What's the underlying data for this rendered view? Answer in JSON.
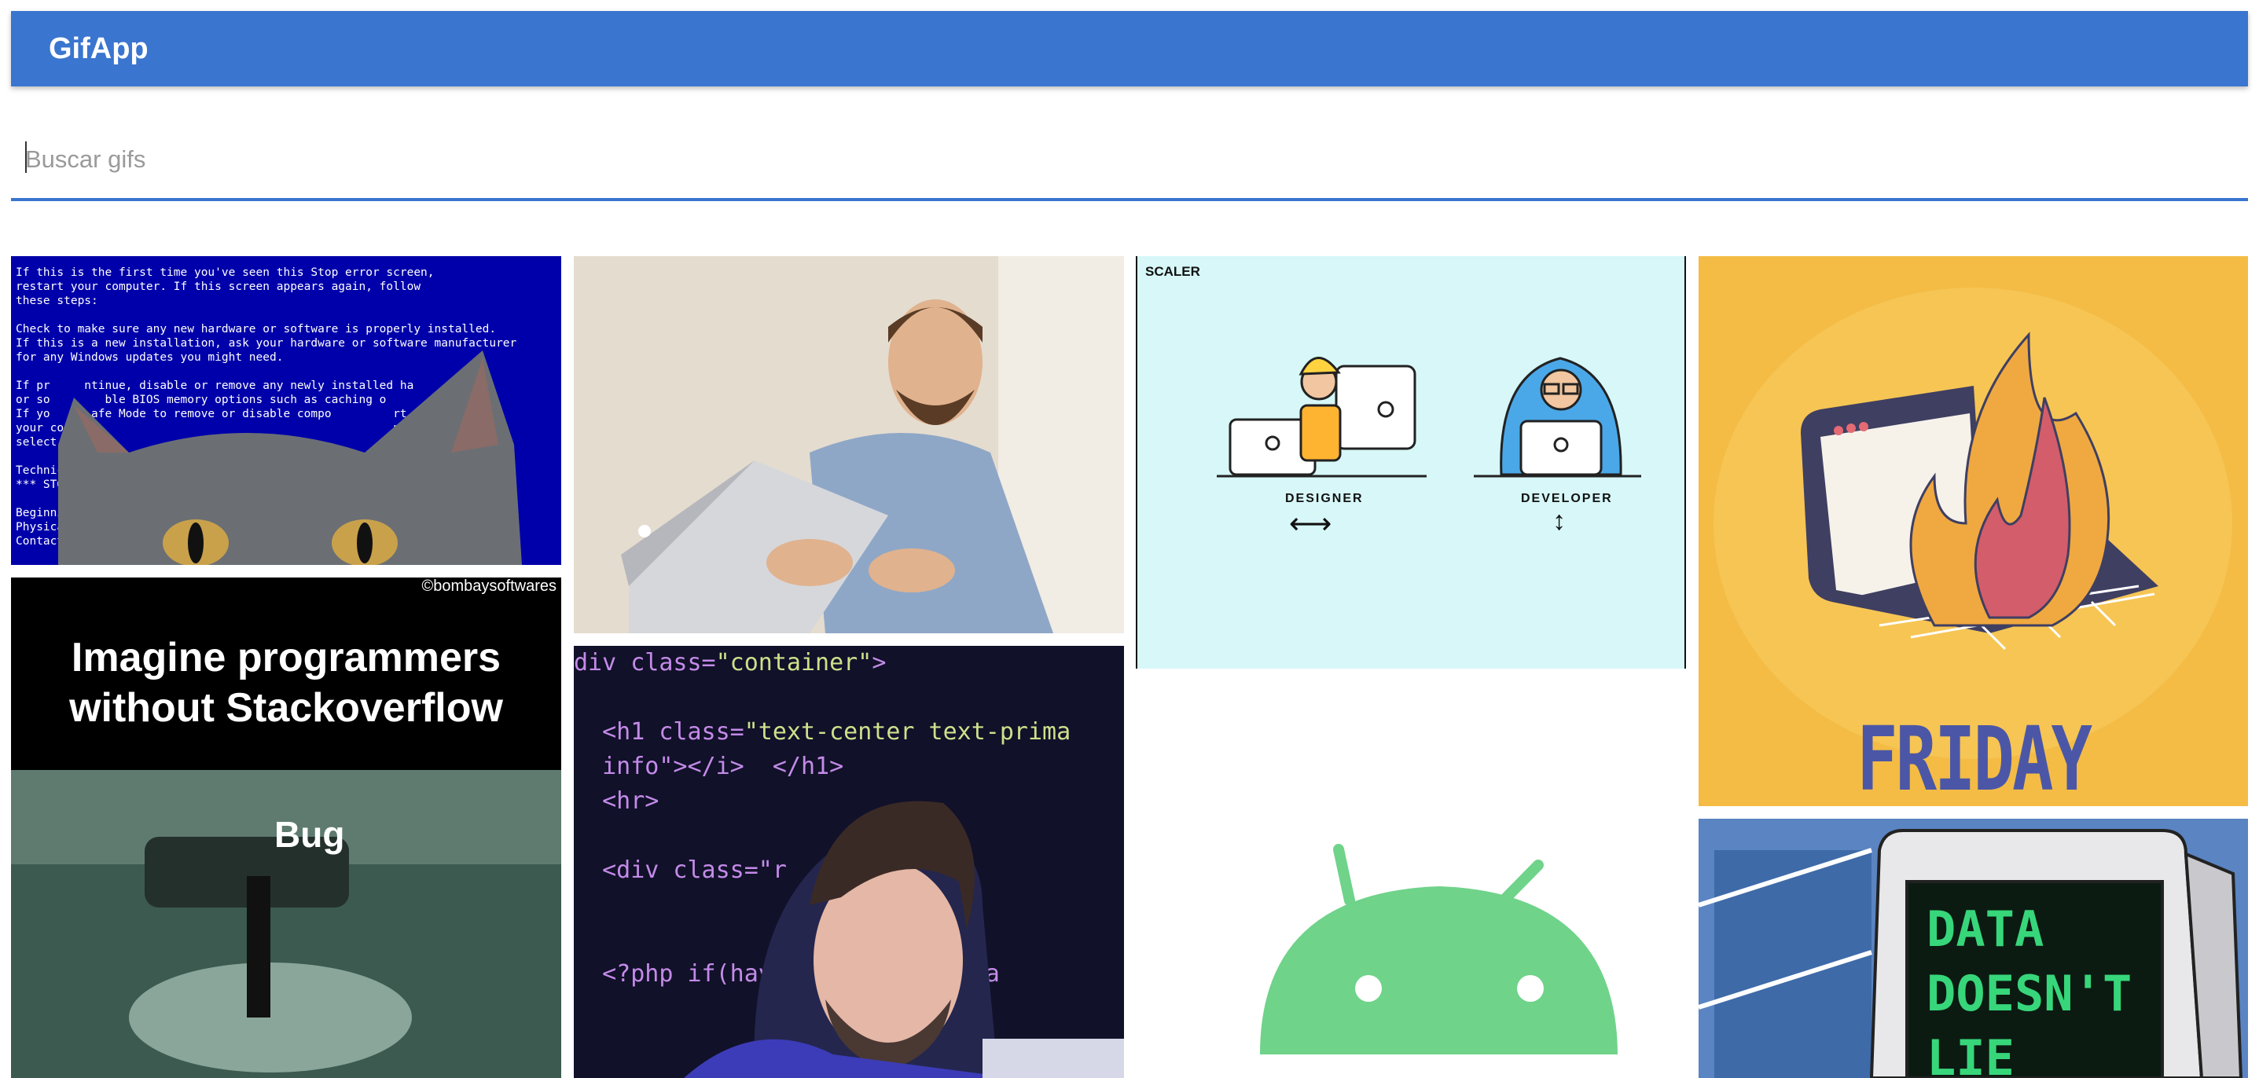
{
  "app": {
    "title": "GifApp"
  },
  "search": {
    "placeholder": "Buscar gifs",
    "value": ""
  },
  "colors": {
    "primary": "#3a75cf",
    "background": "#ffffff"
  },
  "gifs": [
    {
      "id": "bsod-cat",
      "text_lines": [
        "If this is the first time you've seen this Stop error screen,",
        "restart your computer. If this screen appears again, follow",
        "these steps:",
        "",
        "Check to make sure any new hardware or software is properly installed.",
        "If this is a new installation, ask your hardware or software manufacturer",
        "for any Windows updates you might need.",
        "",
        "If pr     ntinue, disable or remove any newly installed ha       ",
        "or so        ble BIOS memory options such as caching o        g.",
        "If yo      afe Mode to remove or disable compo         rt",
        "your co                                                n",
        "select S",
        "",
        "Technical",
        "*** STOP: 0                                            000)",
        "",
        "Beginning dum",
        "Physical memo",
        "Contact your                                         r further"
      ]
    },
    {
      "id": "stackoverflow-meme",
      "credit": "©bombaysoftwares",
      "headline_line1": "Imagine programmers",
      "headline_line2": "without Stackoverflow",
      "overlay": "Bug"
    },
    {
      "id": "excited-laptop-man"
    },
    {
      "id": "code-developer",
      "code_lines": [
        [
          "div class=",
          "\"container\"",
          ">"
        ],
        [
          "",
          "",
          ""
        ],
        [
          "  <h1 class=",
          "\"text-center text-prima",
          ""
        ],
        [
          "  info\"></i>  </h1>",
          "",
          ""
        ],
        [
          "  <hr>",
          "",
          ""
        ],
        [
          "",
          "",
          ""
        ],
        [
          "  <div class=\"r",
          "",
          ""
        ],
        [
          "",
          "",
          ""
        ],
        [
          "",
          "",
          ""
        ],
        [
          "  <?php if(have",
          "",
          "     : while(ha"
        ]
      ]
    },
    {
      "id": "designer-vs-developer",
      "logo": "SCALER",
      "label_left": "DESIGNER",
      "label_right": "DEVELOPER",
      "arrow_left": "⟷",
      "arrow_right": "↕"
    },
    {
      "id": "android-logo",
      "accent": "#6fd38a"
    },
    {
      "id": "friday-deploy",
      "caption": "FRIDAY DEPLOY",
      "accent": "#4b57a6"
    },
    {
      "id": "data-doesnt-lie",
      "screen_lines": [
        "DATA",
        "DOESN'T",
        "LIE"
      ]
    }
  ]
}
